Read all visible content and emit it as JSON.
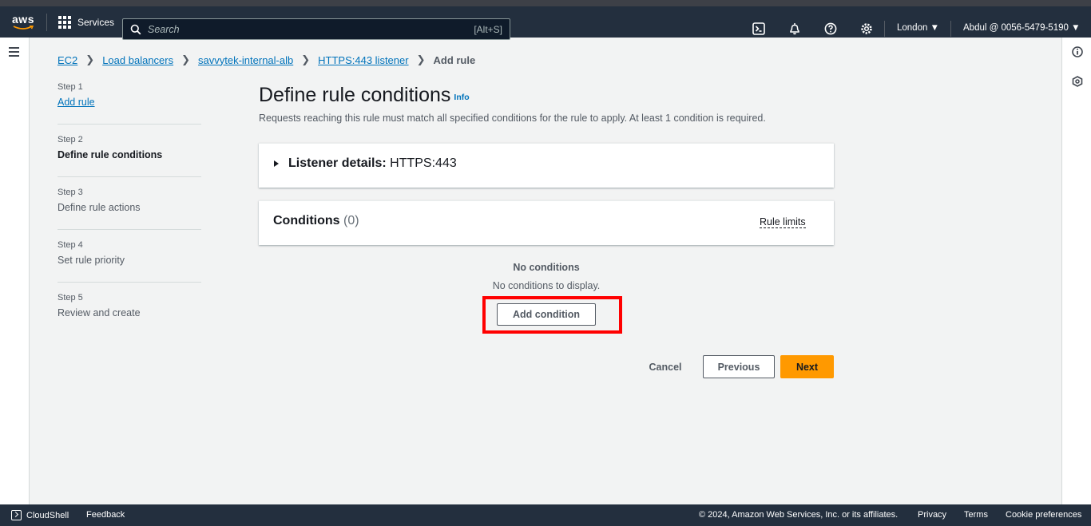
{
  "topbar": {
    "logo_text": "aws",
    "services_label": "Services",
    "search_placeholder": "Search",
    "search_shortcut": "[Alt+S]",
    "region": "London ▼",
    "account": "Abdul @ 0056-5479-5190 ▼"
  },
  "breadcrumb": {
    "items": [
      "EC2",
      "Load balancers",
      "savvytek-internal-alb",
      "HTTPS:443 listener"
    ],
    "current": "Add rule"
  },
  "steps": [
    {
      "num": "Step 1",
      "label": "Add rule",
      "state": "link"
    },
    {
      "num": "Step 2",
      "label": "Define rule conditions",
      "state": "active"
    },
    {
      "num": "Step 3",
      "label": "Define rule actions",
      "state": "disabled"
    },
    {
      "num": "Step 4",
      "label": "Set rule priority",
      "state": "disabled"
    },
    {
      "num": "Step 5",
      "label": "Review and create",
      "state": "disabled"
    }
  ],
  "main": {
    "title": "Define rule conditions",
    "info_link": "Info",
    "description": "Requests reaching this rule must match all specified conditions for the rule to apply. At least 1 condition is required.",
    "listener_label": "Listener details:",
    "listener_value": "HTTPS:443",
    "conditions_title": "Conditions",
    "conditions_count": "(0)",
    "rule_limits": "Rule limits",
    "empty_title": "No conditions",
    "empty_desc": "No conditions to display.",
    "add_condition": "Add condition",
    "cancel": "Cancel",
    "previous": "Previous",
    "next": "Next"
  },
  "footer": {
    "cloudshell": "CloudShell",
    "feedback": "Feedback",
    "copyright": "© 2024, Amazon Web Services, Inc. or its affiliates.",
    "privacy": "Privacy",
    "terms": "Terms",
    "cookie": "Cookie preferences"
  },
  "colors": {
    "nav_bg": "#232f3e",
    "link": "#0073bb",
    "primary_button": "#ff9900",
    "highlight": "#ff0000"
  }
}
